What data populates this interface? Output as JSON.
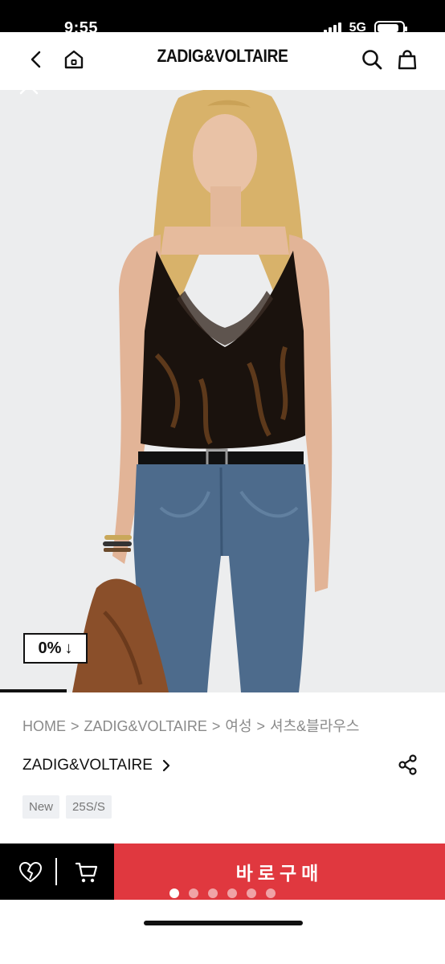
{
  "status": {
    "time": "9:55",
    "network": "5G",
    "battery_level": 0.85
  },
  "header": {
    "brand": "ZADIG&VOLTAIRE",
    "back_icon": "chevron-left-icon",
    "home_icon": "home-icon",
    "search_icon": "search-icon",
    "bag_icon": "shopping-bag-icon"
  },
  "hero": {
    "close_icon": "close-icon",
    "discount": "0%",
    "discount_arrow": "↓",
    "image_progress": 0.15
  },
  "breadcrumb": [
    "HOME",
    "ZADIG&VOLTAIRE",
    "여성",
    "셔츠&블라우스"
  ],
  "breadcrumb_sep": ">",
  "product": {
    "brand": "ZADIG&VOLTAIRE",
    "tags": [
      "New",
      "25S/S"
    ]
  },
  "actions": {
    "buy_label": "바로구매",
    "wish_icon": "broken-heart-icon",
    "cart_icon": "cart-icon",
    "share_icon": "share-icon"
  },
  "pager": {
    "count": 6,
    "active": 0
  },
  "colors": {
    "buy": "#e0383f",
    "bar": "#000000"
  }
}
